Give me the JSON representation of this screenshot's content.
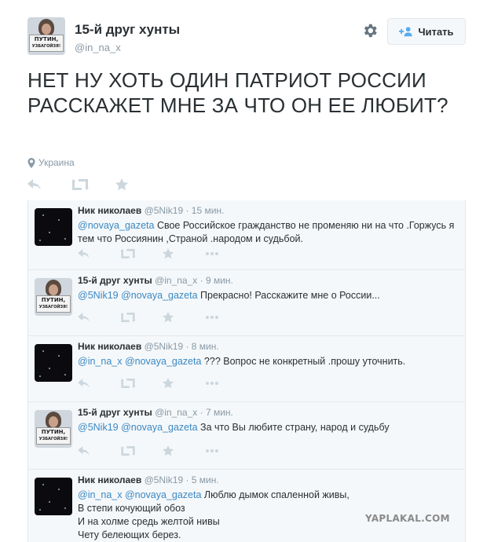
{
  "profile": {
    "display_name": "15-й друг хунты",
    "screen_name": "@in_na_x",
    "follow_label": "Читать",
    "avatar_sign": [
      "ПУТИН,",
      "УЗБАГОЙЗЯ!"
    ]
  },
  "tweet": {
    "text": "НЕТ НУ ХОТЬ ОДИН ПАТРИОТ РОССИИ РАССКАЖЕТ МНЕ ЗА ЧТО ОН ЕЕ ЛЮБИТ?",
    "location": "Украина"
  },
  "icons": [
    "gear-icon",
    "add-user-icon",
    "location-pin-icon",
    "reply-icon",
    "retweet-icon",
    "favorite-icon",
    "more-icon"
  ],
  "colors": {
    "link": "#3b88c3",
    "muted": "#8899a6",
    "text": "#292f33",
    "panel": "#f5f8fa",
    "border": "#e1e8ed"
  },
  "replies": [
    {
      "name": "Ник николаев",
      "handle": "@5Nik19",
      "time": "15 мин.",
      "mentions": "@novaya_gazeta",
      "text": " Свое Российское гражданство не променяю ни на что .Горжусь я тем что Россиянин ,Страной .народом и судьбой."
    },
    {
      "name": "15-й друг хунты",
      "handle": "@in_na_x",
      "time": "9 мин.",
      "mentions": "@5Nik19 @novaya_gazeta",
      "text": " Прекрасно! Расскажите мне о России..."
    },
    {
      "name": "Ник николаев",
      "handle": "@5Nik19",
      "time": "8 мин.",
      "mentions": "@in_na_x @novaya_gazeta",
      "text": " ??? Вопрос не конкретный .прошу уточнить."
    },
    {
      "name": "15-й друг хунты",
      "handle": "@in_na_x",
      "time": "7 мин.",
      "mentions": "@5Nik19 @novaya_gazeta",
      "text": " За что Вы любите страну, народ и судьбу"
    },
    {
      "name": "Ник николаев",
      "handle": "@5Nik19",
      "time": "5 мин.",
      "mentions": "@in_na_x @novaya_gazeta",
      "text": " Люблю дымок спаленной живы,",
      "lines": [
        "В степи кочующий обоз",
        "И на холме средь желтой нивы",
        "Чету белеющих берез."
      ]
    }
  ],
  "watermark": "YAPLAKAL.COM"
}
